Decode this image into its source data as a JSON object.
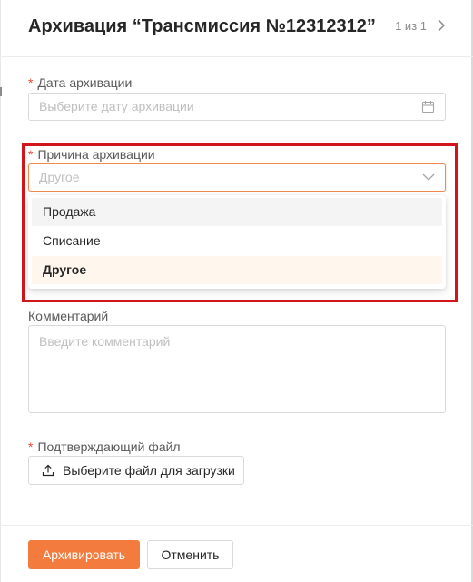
{
  "header": {
    "title": "Архивация “Трансмиссия №12312312”",
    "pager_text": "1 из 1"
  },
  "form": {
    "archive_date": {
      "required_mark": "*",
      "label": "Дата архивации",
      "placeholder": "Выберите дату архивации",
      "icon": "calendar-icon"
    },
    "archive_reason": {
      "required_mark": "*",
      "label": "Причина архивации",
      "value": "Другое",
      "icon": "chevron-down-icon",
      "options": [
        {
          "label": "Продажа",
          "state": "hover"
        },
        {
          "label": "Списание",
          "state": "normal"
        },
        {
          "label": "Другое",
          "state": "selected"
        }
      ]
    },
    "comment": {
      "label": "Комментарий",
      "placeholder": "Введите комментарий"
    },
    "confirm_file": {
      "required_mark": "*",
      "label": "Подтверждающий файл",
      "button_label": "Выберите файл для загрузки",
      "icon": "upload-icon"
    }
  },
  "footer": {
    "archive_label": "Архивировать",
    "cancel_label": "Отменить"
  },
  "colors": {
    "accent": "#f47b3e",
    "required": "#e5483a",
    "highlight_frame": "#d0161b",
    "selected_option_bg": "#fff6ee",
    "hover_option_bg": "#f4f4f4"
  }
}
